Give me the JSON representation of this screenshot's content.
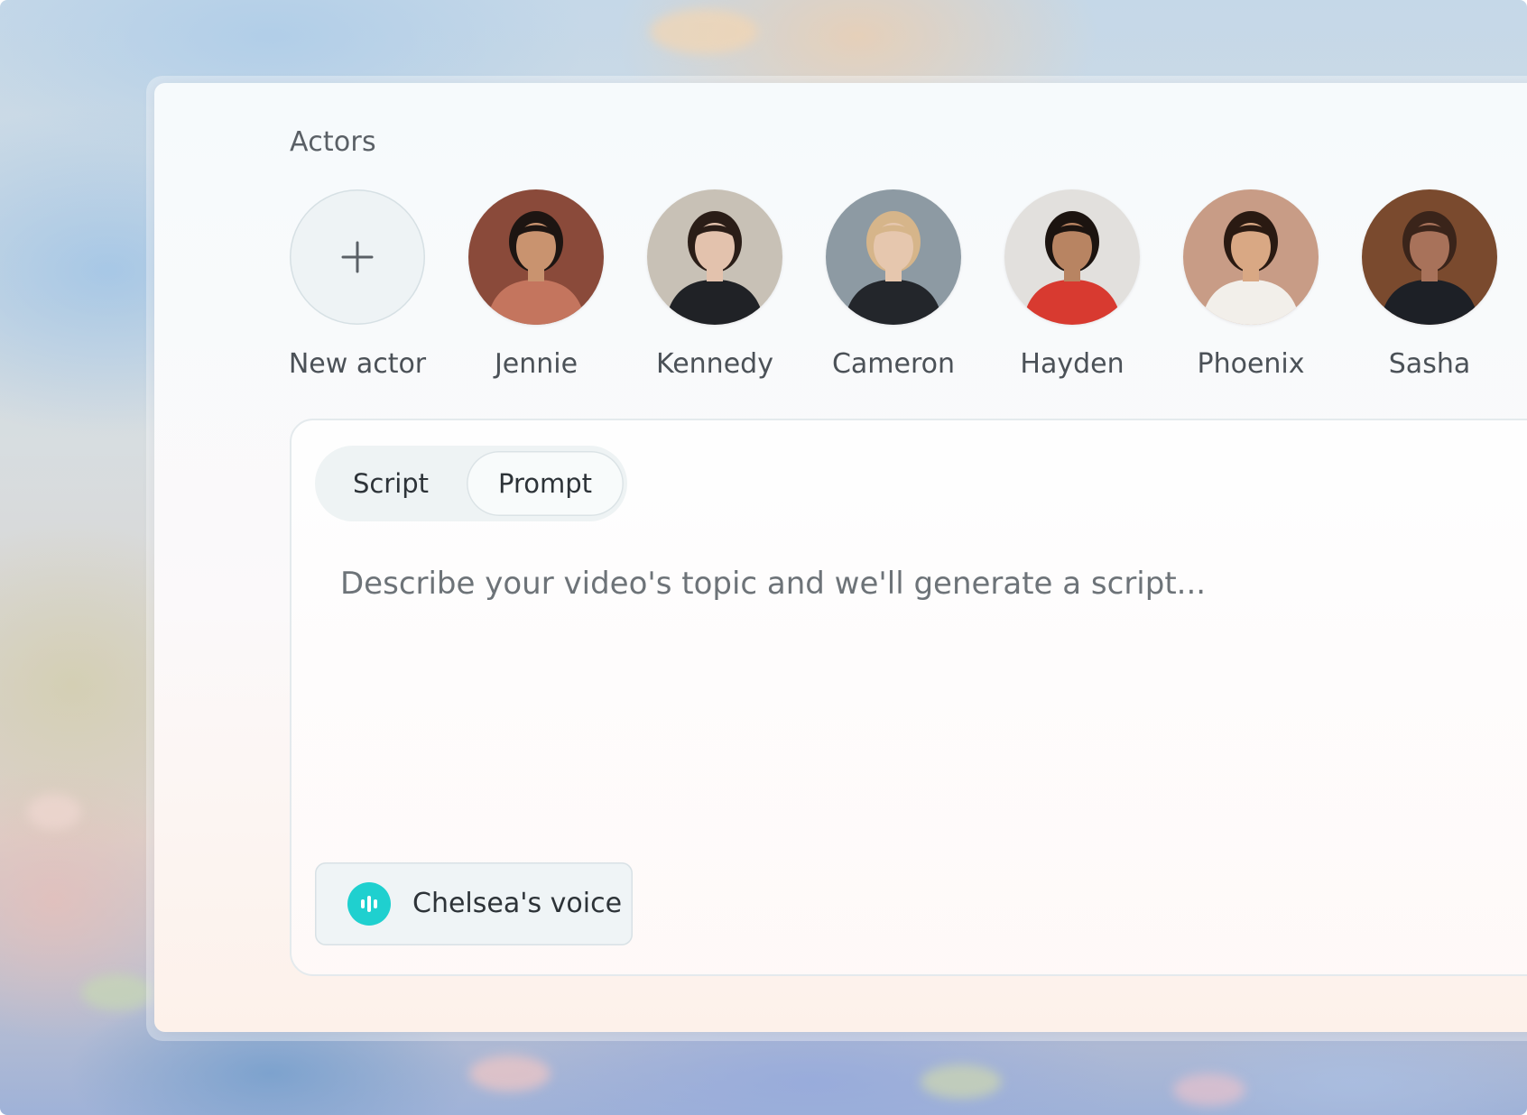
{
  "actors_section": {
    "title": "Actors",
    "new_actor_label": "New actor",
    "actors": [
      {
        "name": "Jennie",
        "skin": "#c9936f",
        "hair": "#1d1512",
        "top": "#c4755e",
        "bg": "#8a4a3a"
      },
      {
        "name": "Kennedy",
        "skin": "#e3c2ad",
        "hair": "#2a1d17",
        "top": "#202226",
        "bg": "#c8c1b6"
      },
      {
        "name": "Cameron",
        "skin": "#e6c7ae",
        "hair": "#d6b58a",
        "top": "#23262b",
        "bg": "#8d9aa3"
      },
      {
        "name": "Hayden",
        "skin": "#b88462",
        "hair": "#1c1410",
        "top": "#d83a30",
        "bg": "#e2e0dd"
      },
      {
        "name": "Phoenix",
        "skin": "#d9a884",
        "hair": "#2a1a12",
        "top": "#f2efea",
        "bg": "#c89c86"
      },
      {
        "name": "Sasha",
        "skin": "#a8725a",
        "hair": "#3a241a",
        "top": "#1d2026",
        "bg": "#7a4a2e"
      }
    ]
  },
  "editor": {
    "tabs": [
      {
        "label": "Script",
        "active": false
      },
      {
        "label": "Prompt",
        "active": true
      }
    ],
    "prompt_placeholder": "Describe your video's topic and we'll generate a script...",
    "voice": {
      "label": "Chelsea's voice",
      "icon": "waveform-icon",
      "icon_color": "#1fd0cf"
    }
  }
}
